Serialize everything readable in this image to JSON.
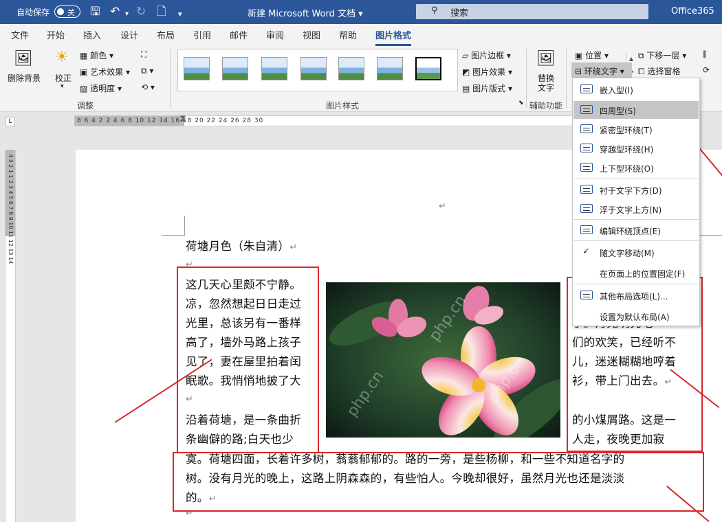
{
  "titlebar": {
    "autosave": "自动保存",
    "autosave_state": "关",
    "doc_title": "新建 Microsoft Word 文档",
    "search_placeholder": "搜索",
    "account": "Office365"
  },
  "tabs": [
    "文件",
    "开始",
    "插入",
    "设计",
    "布局",
    "引用",
    "邮件",
    "审阅",
    "视图",
    "帮助",
    "图片格式"
  ],
  "ribbon": {
    "remove_bg": "删除背景",
    "corrections": "校正",
    "color": "颜色",
    "artistic": "艺术效果",
    "transparency": "透明度",
    "adjust_group": "调整",
    "styles_group": "图片样式",
    "picture_border": "图片边框",
    "picture_effects": "图片效果",
    "picture_layout": "图片版式",
    "alt_text_1": "替换",
    "alt_text_2": "文字",
    "accessibility_group": "辅助功能",
    "position": "位置",
    "wrap_text": "环绕文字",
    "send_backward": "下移一层",
    "selection_pane": "选择窗格"
  },
  "ruler": {
    "numbers": "8  6  4  2     2  4  6  8  10  12  14  16  18  20  22  24  26  28  30",
    "vnumbers": "4  3  2  1     1  2  3  4  5  6  7  8  9  10  11  12  13  14"
  },
  "document": {
    "title": "荷塘月色（朱自清）",
    "left_lines": [
      "这几天心里颇不宁静。",
      "凉，忽然想起日日走过",
      "光里，总该另有一番样",
      "高了，墙外马路上孩子",
      "见了，妻在屋里拍着闰",
      "眠歌。我悄悄地披了大"
    ],
    "left_lines2": [
      "沿着荷塘，是一条曲折",
      "条幽僻的路;白天也少"
    ],
    "right_lines": [
      "子。月光明亮地",
      "们的欢笑，已经听不",
      "儿，迷迷糊糊地哼着",
      "衫，带上门出去。"
    ],
    "right_lines2": [
      "的小煤屑路。这是一",
      "人走，夜晚更加寂"
    ],
    "bottom_lines": [
      "寞。荷塘四面，长着许多树，蓊蓊郁郁的。路的一旁，是些杨柳，和一些不知道名字的",
      "树。没有月光的晚上，这路上阴森森的，有些怕人。今晚却很好，虽然月光也还是淡淡",
      "的。"
    ],
    "para_mark": "↵",
    "watermark": "php.cn"
  },
  "dropdown": {
    "items": [
      {
        "label": "嵌入型(I)"
      },
      {
        "label": "四周型(S)"
      },
      {
        "label": "紧密型环绕(T)"
      },
      {
        "label": "穿越型环绕(H)"
      },
      {
        "label": "上下型环绕(O)"
      },
      {
        "label": "衬于文字下方(D)"
      },
      {
        "label": "浮于文字上方(N)"
      },
      {
        "label": "编辑环绕顶点(E)"
      },
      {
        "label": "随文字移动(M)"
      },
      {
        "label": "在页面上的位置固定(F)"
      },
      {
        "label": "其他布局选项(L)..."
      },
      {
        "label": "设置为默认布局(A)"
      }
    ],
    "selected": "四周型(S)",
    "checked": "随文字移动(M)"
  },
  "colors": {
    "title_bar": "#2b579a",
    "annotation": "#d9262c"
  }
}
